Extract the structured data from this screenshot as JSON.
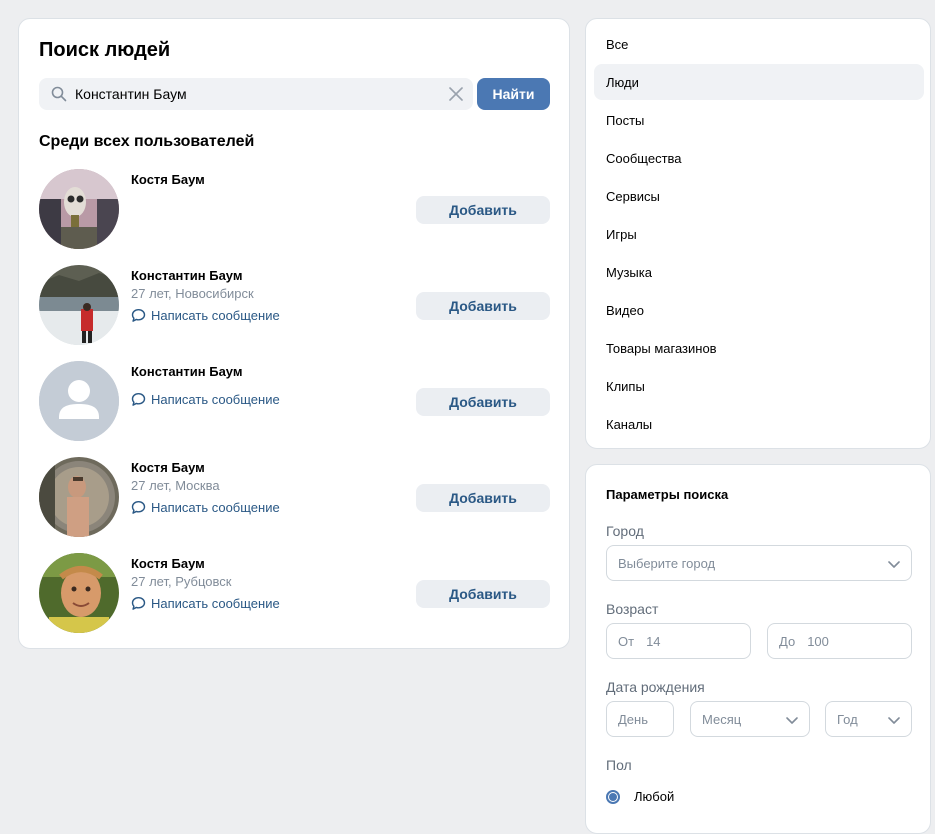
{
  "main": {
    "title": "Поиск людей",
    "search": {
      "value": "Константин Баум",
      "button": "Найти"
    },
    "section_title": "Среди всех пользователей",
    "add_label": "Добавить",
    "message_label": "Написать сообщение",
    "results": [
      {
        "name": "Костя Баум",
        "info": "",
        "has_message": false,
        "avatar": "photo-gasmask"
      },
      {
        "name": "Константин Баум",
        "info": "27 лет, Новосибирск",
        "has_message": true,
        "avatar": "photo-winter-river"
      },
      {
        "name": "Константин Баум",
        "info": "",
        "has_message": true,
        "avatar": "default-avatar"
      },
      {
        "name": "Костя Баум",
        "info": "27 лет, Москва",
        "has_message": true,
        "avatar": "photo-mirror-selfie"
      },
      {
        "name": "Костя Баум",
        "info": "27 лет, Рубцовск",
        "has_message": true,
        "avatar": "photo-face-outdoor"
      }
    ]
  },
  "nav": {
    "items": [
      {
        "label": "Все",
        "active": false
      },
      {
        "label": "Люди",
        "active": true
      },
      {
        "label": "Посты",
        "active": false
      },
      {
        "label": "Сообщества",
        "active": false
      },
      {
        "label": "Сервисы",
        "active": false
      },
      {
        "label": "Игры",
        "active": false
      },
      {
        "label": "Музыка",
        "active": false
      },
      {
        "label": "Видео",
        "active": false
      },
      {
        "label": "Товары магазинов",
        "active": false
      },
      {
        "label": "Клипы",
        "active": false
      },
      {
        "label": "Каналы",
        "active": false
      }
    ]
  },
  "params": {
    "title": "Параметры поиска",
    "city": {
      "label": "Город",
      "placeholder": "Выберите город"
    },
    "age": {
      "label": "Возраст",
      "from_prefix": "От",
      "from_value": "14",
      "to_prefix": "До",
      "to_value": "100"
    },
    "birth": {
      "label": "Дата рождения",
      "day": "День",
      "month": "Месяц",
      "year": "Год"
    },
    "sex": {
      "label": "Пол",
      "option": "Любой"
    }
  },
  "colors": {
    "accent": "#4b78b3",
    "link": "#2a5885",
    "background": "#edeef0"
  }
}
